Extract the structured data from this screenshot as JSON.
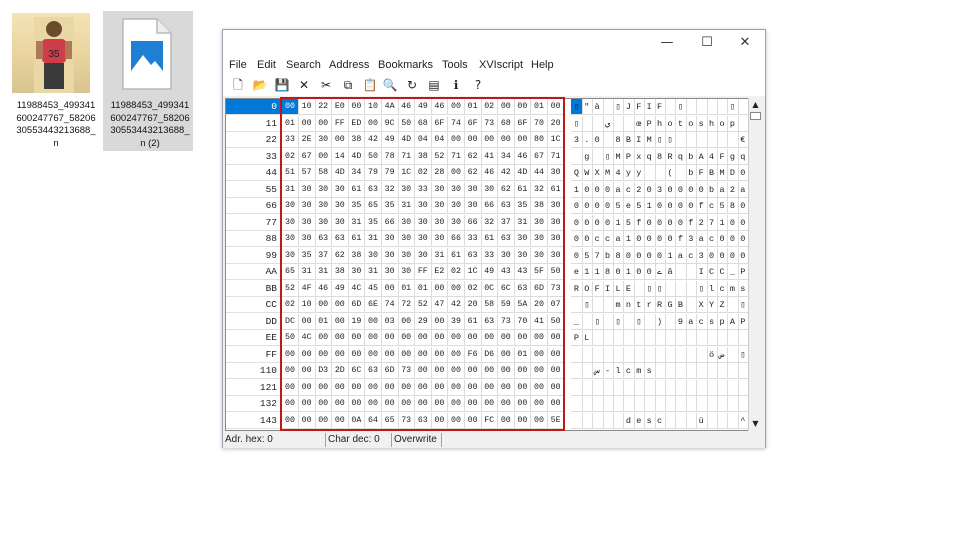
{
  "desktop": {
    "files": [
      {
        "name": "11988453_499341600247767_5820630553443213688_n",
        "label_lines": [
          "11988453_499341",
          "600247767_58206",
          "30553443213688_",
          "n"
        ],
        "icon": "photo-thumbnail-icon"
      },
      {
        "name": "11988453_499341600247767_5820630553443213688_n (2)",
        "label_lines": [
          "11988453_499341",
          "600247767_58206",
          "30553443213688_",
          "n (2)"
        ],
        "icon": "image-document-icon"
      }
    ]
  },
  "window": {
    "controls": {
      "minimize": "—",
      "maximize": "☐",
      "close": "✕"
    },
    "menu": [
      "File",
      "Edit",
      "Search",
      "Address",
      "Bookmarks",
      "Tools",
      "XVIscript",
      "Help"
    ],
    "toolbar_icons": [
      "new-file-icon",
      "open-folder-icon",
      "save-icon",
      "delete-icon",
      "cut-icon",
      "copy-icon",
      "paste-icon",
      "find-icon",
      "replace-icon",
      "properties-icon",
      "script-icon",
      "help-pointer-icon"
    ],
    "toolbar_glyphs": [
      "🗋",
      "📂",
      "💾",
      "✕",
      "✂",
      "⧉",
      "📋",
      "🔍",
      "↻",
      "▤",
      "ℹ",
      "?"
    ],
    "accent": "#0078d7",
    "highlight_color": "#c01818",
    "rows": [
      {
        "addr": "0",
        "hex": [
          "00",
          "10",
          "22",
          "E0",
          "00",
          "10",
          "4A",
          "46",
          "49",
          "46",
          "00",
          "01",
          "02",
          "00",
          "00",
          "01",
          "00"
        ],
        "chars": [
          "▯",
          "\"",
          "à",
          "",
          "▯",
          "J",
          "F",
          "I",
          "F",
          "",
          "▯",
          "",
          "",
          "",
          "",
          "▯",
          ""
        ]
      },
      {
        "addr": "11",
        "hex": [
          "01",
          "00",
          "00",
          "FF",
          "ED",
          "00",
          "9C",
          "50",
          "68",
          "6F",
          "74",
          "6F",
          "73",
          "68",
          "6F",
          "70",
          "20"
        ],
        "chars": [
          "▯",
          "",
          "",
          "ي",
          "",
          "",
          "œ",
          "P",
          "h",
          "o",
          "t",
          "o",
          "s",
          "h",
          "o",
          "p",
          ""
        ]
      },
      {
        "addr": "22",
        "hex": [
          "33",
          "2E",
          "30",
          "00",
          "38",
          "42",
          "49",
          "4D",
          "04",
          "04",
          "00",
          "00",
          "00",
          "00",
          "00",
          "80",
          "1C"
        ],
        "chars": [
          "3",
          ".",
          "0",
          "",
          "8",
          "B",
          "I",
          "M",
          "▯",
          "▯",
          "",
          "",
          "",
          "",
          "",
          "",
          "€"
        ]
      },
      {
        "addr": "33",
        "hex": [
          "02",
          "67",
          "00",
          "14",
          "4D",
          "50",
          "78",
          "71",
          "38",
          "52",
          "71",
          "62",
          "41",
          "34",
          "46",
          "67",
          "71"
        ],
        "chars": [
          "",
          "g",
          "",
          "▯",
          "M",
          "P",
          "x",
          "q",
          "8",
          "R",
          "q",
          "b",
          "A",
          "4",
          "F",
          "g",
          "q"
        ]
      },
      {
        "addr": "44",
        "hex": [
          "51",
          "57",
          "58",
          "4D",
          "34",
          "79",
          "79",
          "1C",
          "02",
          "28",
          "00",
          "62",
          "46",
          "42",
          "4D",
          "44",
          "30"
        ],
        "chars": [
          "Q",
          "W",
          "X",
          "M",
          "4",
          "y",
          "y",
          "",
          "",
          "(",
          "",
          "b",
          "F",
          "B",
          "M",
          "D",
          "0"
        ]
      },
      {
        "addr": "55",
        "hex": [
          "31",
          "30",
          "30",
          "30",
          "61",
          "63",
          "32",
          "30",
          "33",
          "30",
          "30",
          "30",
          "30",
          "62",
          "61",
          "32",
          "61"
        ],
        "chars": [
          "1",
          "0",
          "0",
          "0",
          "a",
          "c",
          "2",
          "0",
          "3",
          "0",
          "0",
          "0",
          "0",
          "b",
          "a",
          "2",
          "a"
        ]
      },
      {
        "addr": "66",
        "hex": [
          "30",
          "30",
          "30",
          "30",
          "35",
          "65",
          "35",
          "31",
          "30",
          "30",
          "30",
          "30",
          "66",
          "63",
          "35",
          "38",
          "30"
        ],
        "chars": [
          "0",
          "0",
          "0",
          "0",
          "5",
          "e",
          "5",
          "1",
          "0",
          "0",
          "0",
          "0",
          "f",
          "c",
          "5",
          "8",
          "0"
        ]
      },
      {
        "addr": "77",
        "hex": [
          "30",
          "30",
          "30",
          "30",
          "31",
          "35",
          "66",
          "30",
          "30",
          "30",
          "30",
          "66",
          "32",
          "37",
          "31",
          "30",
          "30"
        ],
        "chars": [
          "0",
          "0",
          "0",
          "0",
          "1",
          "5",
          "f",
          "0",
          "0",
          "0",
          "0",
          "f",
          "2",
          "7",
          "1",
          "0",
          "0"
        ]
      },
      {
        "addr": "88",
        "hex": [
          "30",
          "30",
          "63",
          "63",
          "61",
          "31",
          "30",
          "30",
          "30",
          "30",
          "66",
          "33",
          "61",
          "63",
          "30",
          "30",
          "30"
        ],
        "chars": [
          "0",
          "0",
          "c",
          "c",
          "a",
          "1",
          "0",
          "0",
          "0",
          "0",
          "f",
          "3",
          "a",
          "c",
          "0",
          "0",
          "0"
        ]
      },
      {
        "addr": "99",
        "hex": [
          "30",
          "35",
          "37",
          "62",
          "38",
          "30",
          "30",
          "30",
          "30",
          "31",
          "61",
          "63",
          "33",
          "30",
          "30",
          "30",
          "30"
        ],
        "chars": [
          "0",
          "5",
          "7",
          "b",
          "8",
          "0",
          "0",
          "0",
          "0",
          "1",
          "a",
          "c",
          "3",
          "0",
          "0",
          "0",
          "0"
        ]
      },
      {
        "addr": "AA",
        "hex": [
          "65",
          "31",
          "31",
          "38",
          "30",
          "31",
          "30",
          "30",
          "FF",
          "E2",
          "02",
          "1C",
          "49",
          "43",
          "43",
          "5F",
          "50"
        ],
        "chars": [
          "e",
          "1",
          "1",
          "8",
          "0",
          "1",
          "0",
          "0",
          "ے",
          "â",
          "",
          "",
          "I",
          "C",
          "C",
          "_",
          "P"
        ]
      },
      {
        "addr": "BB",
        "hex": [
          "52",
          "4F",
          "46",
          "49",
          "4C",
          "45",
          "00",
          "01",
          "01",
          "00",
          "00",
          "02",
          "0C",
          "6C",
          "63",
          "6D",
          "73"
        ],
        "chars": [
          "R",
          "O",
          "F",
          "I",
          "L",
          "E",
          "",
          "▯",
          "▯",
          "",
          "",
          "",
          "▯",
          "l",
          "c",
          "m",
          "s"
        ]
      },
      {
        "addr": "CC",
        "hex": [
          "02",
          "10",
          "00",
          "00",
          "6D",
          "6E",
          "74",
          "72",
          "52",
          "47",
          "42",
          "20",
          "58",
          "59",
          "5A",
          "20",
          "07"
        ],
        "chars": [
          "",
          "▯",
          "",
          "",
          "m",
          "n",
          "t",
          "r",
          "R",
          "G",
          "B",
          "",
          "X",
          "Y",
          "Z",
          "",
          "▯"
        ]
      },
      {
        "addr": "DD",
        "hex": [
          "DC",
          "00",
          "01",
          "00",
          "19",
          "00",
          "03",
          "00",
          "29",
          "00",
          "39",
          "61",
          "63",
          "73",
          "70",
          "41",
          "50"
        ],
        "chars": [
          "_",
          "",
          "▯",
          "",
          "▯",
          "",
          "▯",
          "",
          ")",
          "",
          "9",
          "a",
          "c",
          "s",
          "p",
          "A",
          "P"
        ]
      },
      {
        "addr": "EE",
        "hex": [
          "50",
          "4C",
          "00",
          "00",
          "00",
          "00",
          "00",
          "00",
          "00",
          "00",
          "00",
          "00",
          "00",
          "00",
          "00",
          "00",
          "00"
        ],
        "chars": [
          "P",
          "L",
          "",
          "",
          "",
          "",
          "",
          "",
          "",
          "",
          "",
          "",
          "",
          "",
          "",
          "",
          ""
        ]
      },
      {
        "addr": "FF",
        "hex": [
          "00",
          "00",
          "00",
          "00",
          "00",
          "00",
          "00",
          "00",
          "00",
          "00",
          "00",
          "F6",
          "D6",
          "00",
          "01",
          "00",
          "00"
        ],
        "chars": [
          "",
          "",
          "",
          "",
          "",
          "",
          "",
          "",
          "",
          "",
          "",
          "",
          "",
          "ö",
          "ض",
          "",
          "▯"
        ]
      },
      {
        "addr": "110",
        "hex": [
          "00",
          "00",
          "D3",
          "2D",
          "6C",
          "63",
          "6D",
          "73",
          "00",
          "00",
          "00",
          "00",
          "00",
          "00",
          "00",
          "00",
          "00"
        ],
        "chars": [
          "",
          "",
          "س",
          "-",
          "l",
          "c",
          "m",
          "s",
          "",
          "",
          "",
          "",
          "",
          "",
          "",
          "",
          ""
        ]
      },
      {
        "addr": "121",
        "hex": [
          "00",
          "00",
          "00",
          "00",
          "00",
          "00",
          "00",
          "00",
          "00",
          "00",
          "00",
          "00",
          "00",
          "00",
          "00",
          "00",
          "00"
        ],
        "chars": [
          "",
          "",
          "",
          "",
          "",
          "",
          "",
          "",
          "",
          "",
          "",
          "",
          "",
          "",
          "",
          "",
          ""
        ]
      },
      {
        "addr": "132",
        "hex": [
          "00",
          "00",
          "00",
          "00",
          "00",
          "00",
          "00",
          "00",
          "00",
          "00",
          "00",
          "00",
          "00",
          "00",
          "00",
          "00",
          "00"
        ],
        "chars": [
          "",
          "",
          "",
          "",
          "",
          "",
          "",
          "",
          "",
          "",
          "",
          "",
          "",
          "",
          "",
          "",
          ""
        ]
      },
      {
        "addr": "143",
        "hex": [
          "00",
          "00",
          "00",
          "00",
          "0A",
          "64",
          "65",
          "73",
          "63",
          "00",
          "00",
          "00",
          "FC",
          "00",
          "00",
          "00",
          "5E"
        ],
        "chars": [
          "",
          "",
          "",
          "",
          "",
          "d",
          "e",
          "s",
          "c",
          "",
          "",
          "",
          "ü",
          "",
          "",
          "",
          "^"
        ]
      }
    ],
    "status": {
      "address": "Adr. hex: 0",
      "char": "Char dec: 0",
      "mode": "Overwrite"
    }
  }
}
